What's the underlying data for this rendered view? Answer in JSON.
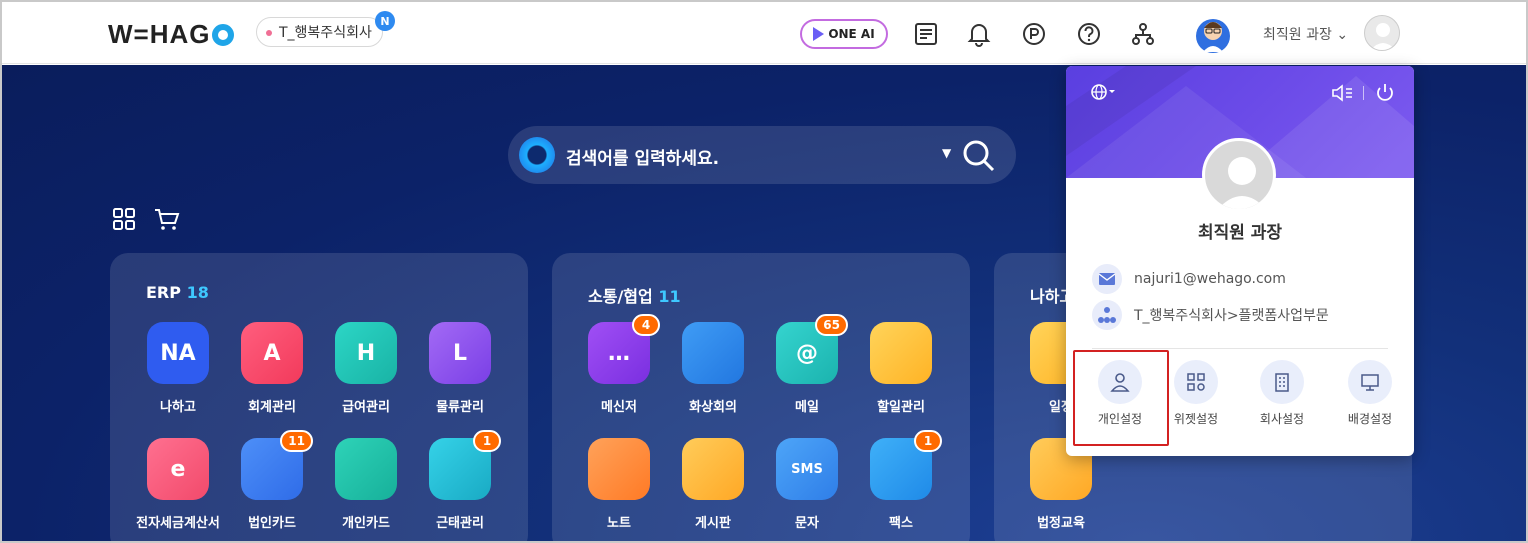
{
  "header": {
    "logo_text": "W=HAG",
    "company": "T_행복주식회사",
    "company_badge": "N",
    "oneai_label": "ONE AI",
    "user_label": "최직원 과장",
    "user_caret": "⌄"
  },
  "search": {
    "placeholder": "검색어를 입력하세요.",
    "caret": "▼"
  },
  "panels": [
    {
      "title": "ERP",
      "count": "18",
      "apps": [
        {
          "label": "나하고",
          "tile_text": "NA",
          "color": "#2f5cf0"
        },
        {
          "label": "회계관리",
          "tile_text": "A",
          "color": "#f24a6b"
        },
        {
          "label": "급여관리",
          "tile_text": "H",
          "color": "#20c3b5"
        },
        {
          "label": "물류관리",
          "tile_text": "L",
          "color": "#8c4ff0"
        },
        {
          "label": "전자세금계산서",
          "tile_text": "e",
          "color": "#f55a7a"
        },
        {
          "label": "법인카드",
          "tile_text": "",
          "color": "#3b7ef5",
          "badge": "11"
        },
        {
          "label": "개인카드",
          "tile_text": "",
          "color": "#1fc0a6"
        },
        {
          "label": "근태관리",
          "tile_text": "",
          "color": "#22bfd8",
          "badge": "1"
        }
      ]
    },
    {
      "title": "소통/협업",
      "count": "11",
      "apps": [
        {
          "label": "메신저",
          "tile_text": "…",
          "color": "#8a3ff0",
          "badge": "4"
        },
        {
          "label": "화상회의",
          "tile_text": "",
          "color": "#2f8ef0"
        },
        {
          "label": "메일",
          "tile_text": "@",
          "color": "#2bc5c0",
          "badge": "65"
        },
        {
          "label": "할일관리",
          "tile_text": "",
          "color": "#ffc53d"
        },
        {
          "label": "노트",
          "tile_text": "",
          "color": "#ff8a3d"
        },
        {
          "label": "게시판",
          "tile_text": "",
          "color": "#ffb83d"
        },
        {
          "label": "문자",
          "tile_text": "SMS",
          "color": "#2f8ef0"
        },
        {
          "label": "팩스",
          "tile_text": "",
          "color": "#2a9ef5",
          "badge": "1"
        }
      ]
    },
    {
      "title": "나하고",
      "count": "",
      "apps": [
        {
          "label": "일정",
          "tile_text": "",
          "color": "#ffb83d"
        },
        {
          "label": "법정교육",
          "tile_text": "",
          "color": "#ffb83d"
        }
      ]
    }
  ],
  "dropdown": {
    "name": "최직원 과장",
    "email": "najuri1@wehago.com",
    "org": "T_행복주식회사>플랫폼사업부문",
    "buttons": [
      "개인설정",
      "위젯설정",
      "회사설정",
      "배경설정"
    ]
  },
  "colors": {
    "brand_blue": "#1fa5e8",
    "header_bg": "#ffffff",
    "main_bg": "#0c2268",
    "dropdown_accent": "#6b4be8",
    "highlight": "#d32121",
    "badge_orange": "#ff6a00"
  }
}
